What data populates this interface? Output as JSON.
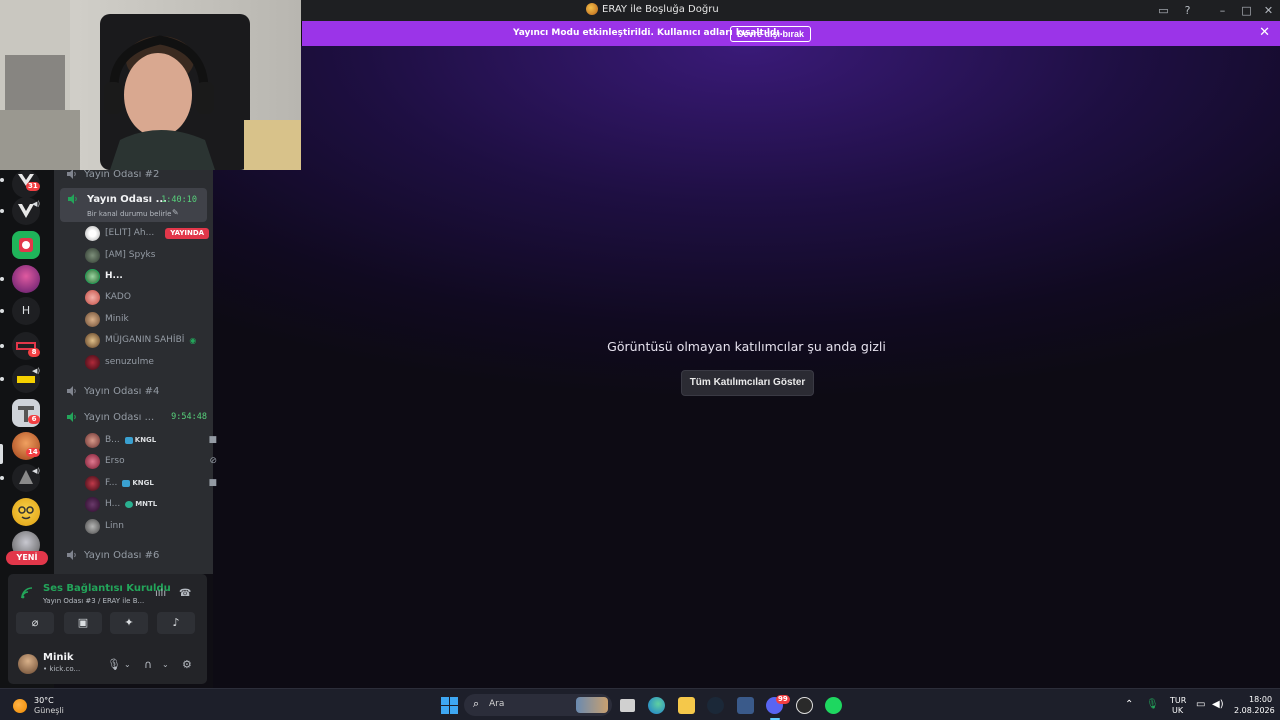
{
  "window": {
    "title": "ERAY ile Boşluğa Doğru"
  },
  "banner": {
    "message": "Yayıncı Modu etkinleştirildi. Kullanıcı adları kısaltıldı.",
    "button": "Devre dışı bırak"
  },
  "stage": {
    "message": "Görüntüsü olmayan katılımcılar şu anda gizli",
    "button": "Tüm Katılımcıları Göster"
  },
  "servers": {
    "badges": [
      "31",
      "8",
      "6",
      "14"
    ],
    "letter": "H",
    "new_label": "YENİ"
  },
  "channels": [
    {
      "name": "Yayın Odası #2"
    },
    {
      "name": "Yayın Odası ...",
      "time": "1:40:10",
      "status": "Bir kanal durumu belirle"
    },
    {
      "name": "Yayın Odası #4"
    },
    {
      "name": "Yayın Odası ...",
      "time": "9:54:48"
    },
    {
      "name": "Yayın Odası #6"
    }
  ],
  "members_a": [
    {
      "name": "[ELIT] Ah...",
      "live": "YAYINDA"
    },
    {
      "name": "[AM] Spyks"
    },
    {
      "name": "H..."
    },
    {
      "name": "KADO"
    },
    {
      "name": "Minik"
    },
    {
      "name": "MÜJGANIN SAHİBİ"
    },
    {
      "name": "senuzulme"
    }
  ],
  "members_b": [
    {
      "name": "B...",
      "tag": "KNGL"
    },
    {
      "name": "Erso"
    },
    {
      "name": "F...",
      "tag": "KNGL"
    },
    {
      "name": "H...",
      "tag": "MNTL"
    },
    {
      "name": "Linn"
    }
  ],
  "voice": {
    "title": "Ses Bağlantısı Kuruldu",
    "subtitle": "Yayın Odası #3 / ERAY ile B..."
  },
  "user": {
    "name": "Minik",
    "status": "• kick.co..."
  },
  "taskbar": {
    "weather_temp": "30°C",
    "weather_desc": "Güneşli",
    "search": "Ara",
    "lang1": "TUR",
    "lang2": "UK",
    "time": "18:00",
    "date": "2.08.2026",
    "discord_badge": "99"
  },
  "colors": {
    "banner": "#9b34e8",
    "accent_green": "#23a55a",
    "live_red": "#e2374a",
    "stage_purple": "#3a1a78"
  }
}
